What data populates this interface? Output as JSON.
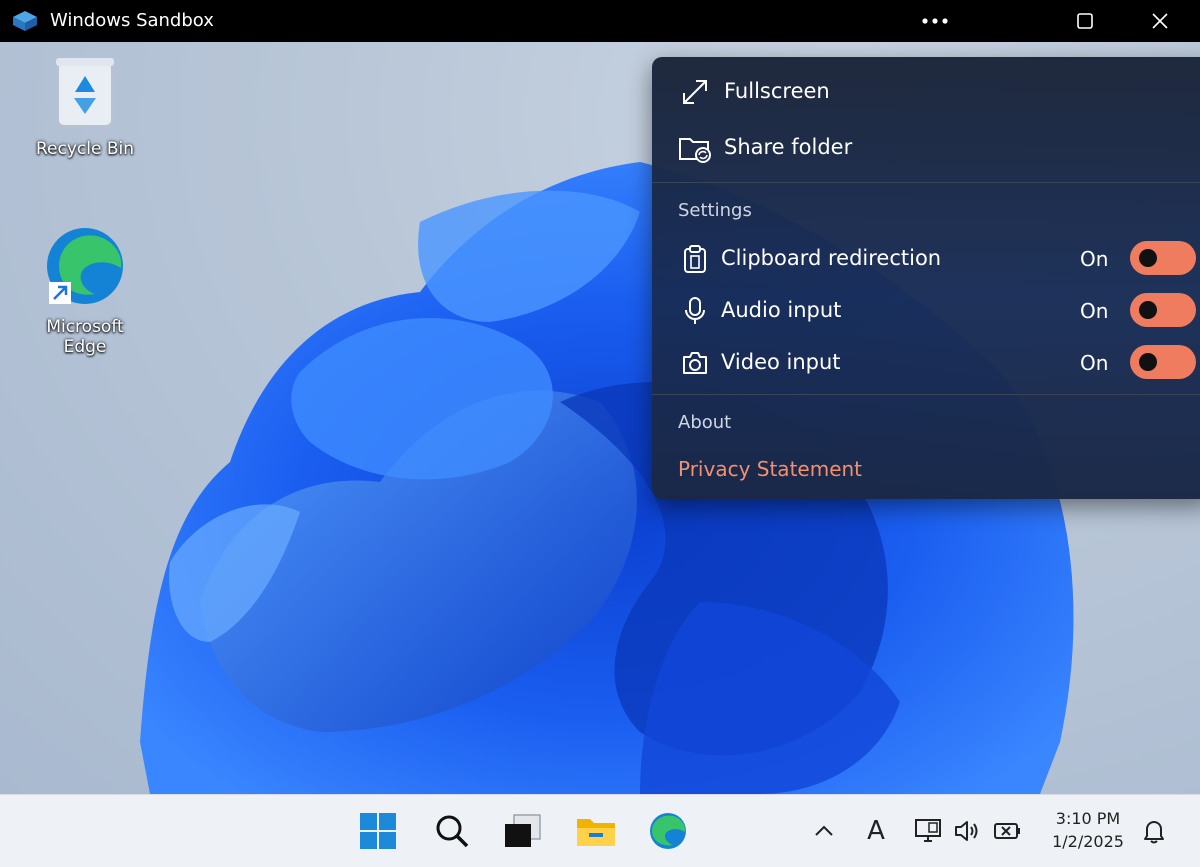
{
  "window": {
    "title": "Windows Sandbox",
    "controls": [
      "more-options",
      "maximize",
      "close"
    ]
  },
  "desktop": {
    "icons": [
      {
        "label": "Recycle Bin",
        "icon": "recycle-bin-icon"
      },
      {
        "label": "Microsoft Edge",
        "icon": "edge-icon"
      }
    ]
  },
  "menu": {
    "fullscreen": "Fullscreen",
    "share_folder": "Share folder",
    "settings_header": "Settings",
    "settings": [
      {
        "label": "Clipboard redirection",
        "state": "On",
        "icon": "clipboard-icon",
        "enabled": true
      },
      {
        "label": "Audio input",
        "state": "On",
        "icon": "microphone-icon",
        "enabled": true
      },
      {
        "label": "Video input",
        "state": "On",
        "icon": "camera-icon",
        "enabled": true
      }
    ],
    "about_header": "About",
    "privacy": "Privacy Statement",
    "accent": "#f07c5f"
  },
  "taskbar": {
    "apps": [
      "start-icon",
      "search-icon",
      "task-view-icon",
      "file-explorer-icon",
      "edge-icon"
    ],
    "tray": {
      "chevron": "^",
      "input_indicator": "A"
    },
    "time": "3:10 PM",
    "date": "1/2/2025"
  }
}
